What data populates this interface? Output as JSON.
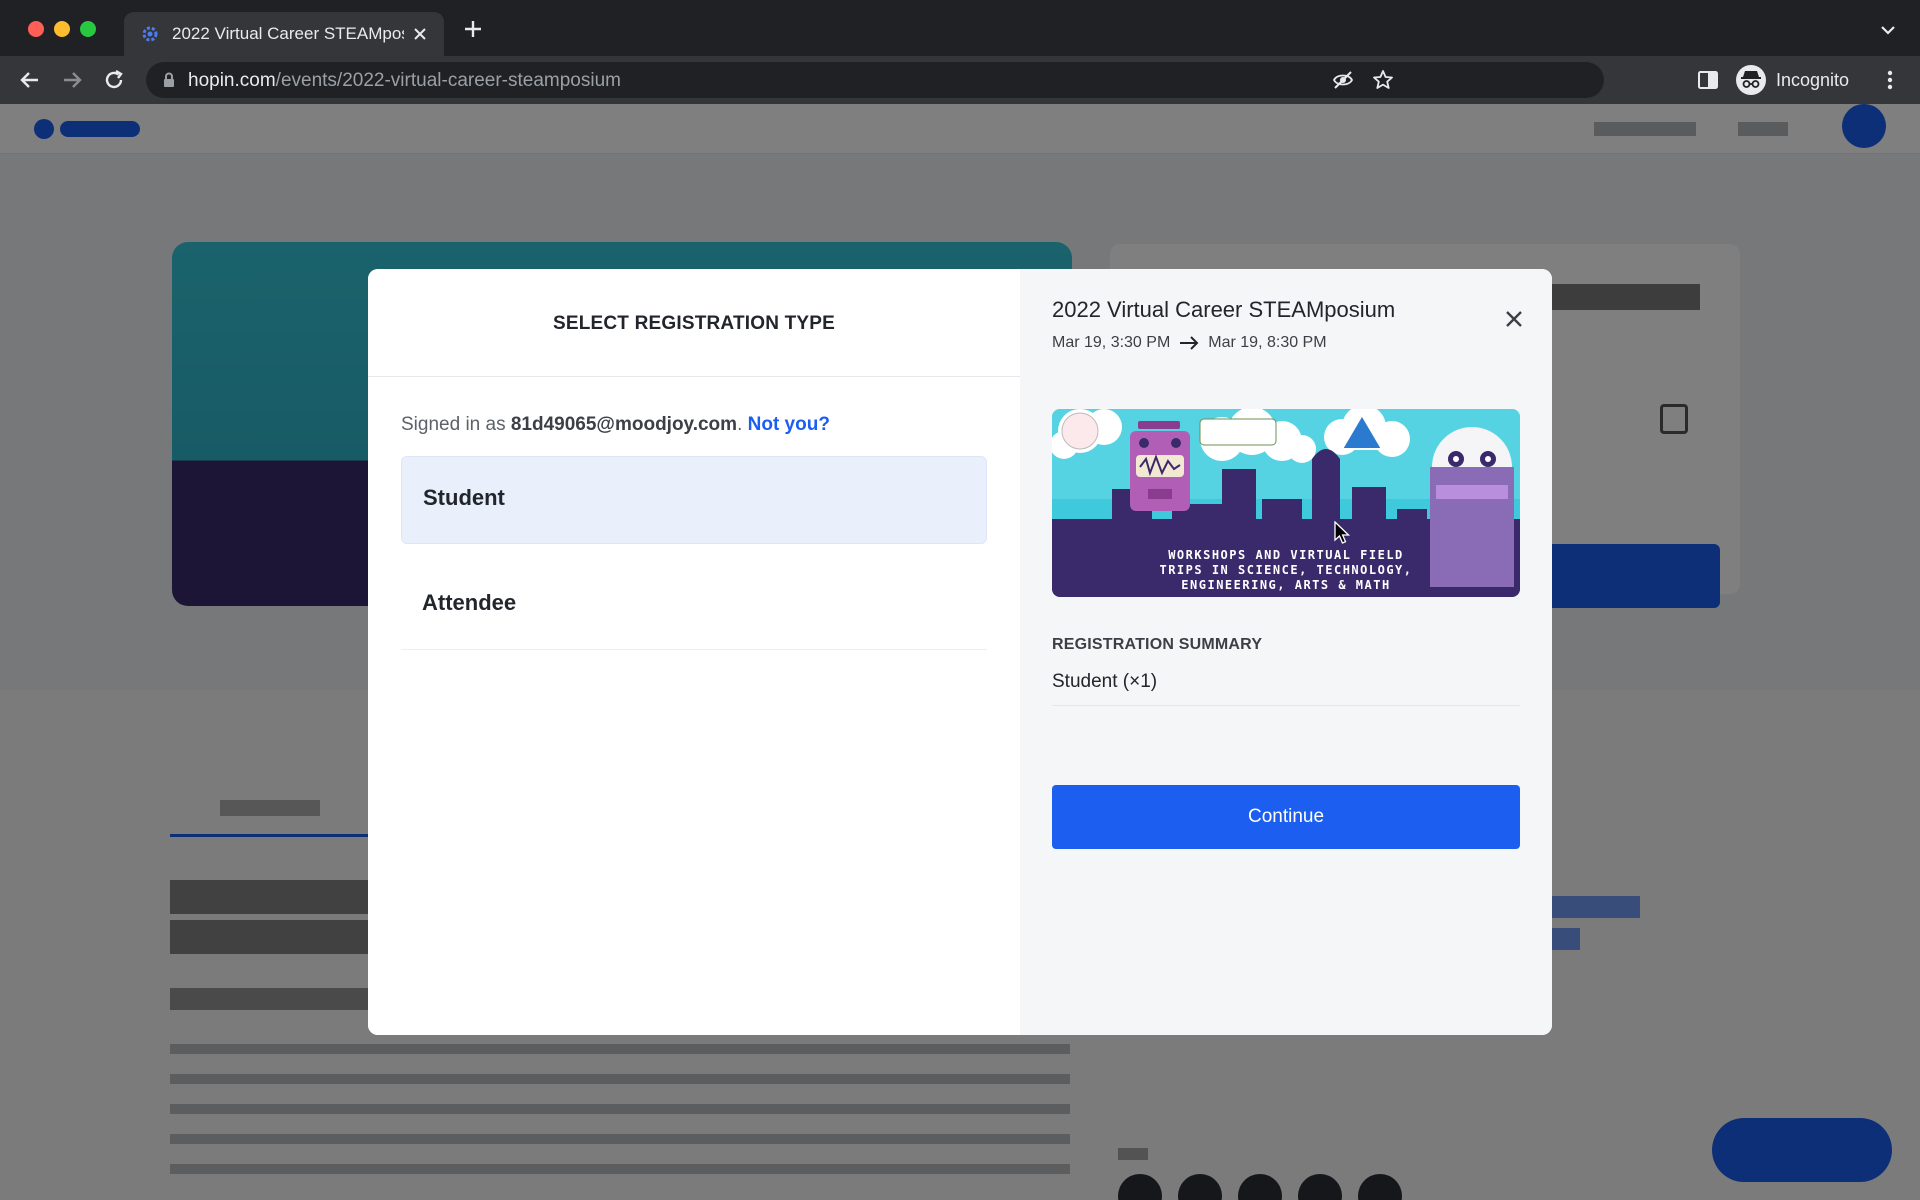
{
  "browser": {
    "tab_title": "2022 Virtual Career STEAMposium",
    "url_host": "hopin.com",
    "url_path": "/events/2022-virtual-career-steamposium",
    "profile_label": "Incognito"
  },
  "modal": {
    "left": {
      "heading": "SELECT REGISTRATION TYPE",
      "signed_in_prefix": "Signed in as",
      "email": "81d49065@moodjoy.com",
      "period": ".",
      "not_you": "Not you?",
      "options": [
        {
          "label": "Student",
          "selected": true
        },
        {
          "label": "Attendee",
          "selected": false
        }
      ]
    },
    "right": {
      "event_title": "2022 Virtual Career STEAMposium",
      "start": "Mar 19, 3:30 PM",
      "end": "Mar 19, 8:30 PM",
      "banner": {
        "line1": "WORKSHOPS AND VIRTUAL FIELD",
        "line2": "TRIPS IN SCIENCE, TECHNOLOGY,",
        "line3": "ENGINEERING, ARTS & MATH"
      },
      "summary_label": "REGISTRATION SUMMARY",
      "summary_item": "Student (×1)",
      "continue_label": "Continue"
    }
  },
  "colors": {
    "primary": "#1b5ef0",
    "selected_option_bg": "#e9f0fc",
    "right_panel_bg": "#f5f6f8"
  },
  "icons": [
    "favicon-icon",
    "close-tab-icon",
    "new-tab-icon",
    "tab-search-icon",
    "back-icon",
    "forward-icon",
    "reload-icon",
    "lock-icon",
    "eye-off-icon",
    "star-icon",
    "side-panel-icon",
    "incognito-icon",
    "kebab-menu-icon",
    "arrow-right-icon",
    "close-icon",
    "cursor-icon"
  ]
}
